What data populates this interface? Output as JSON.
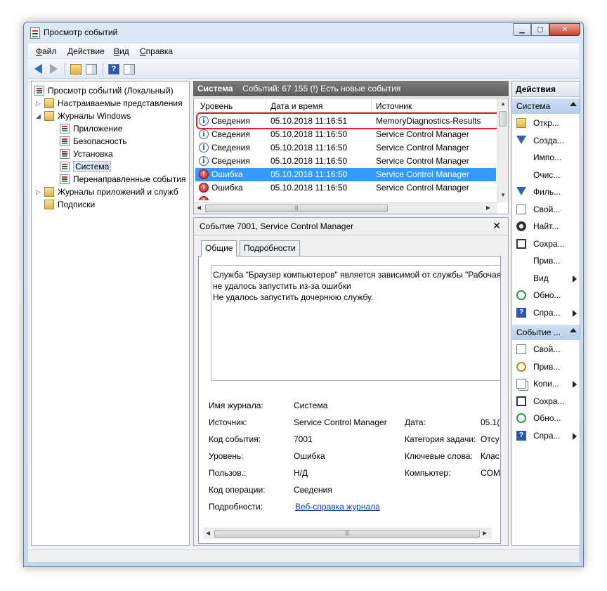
{
  "window": {
    "title": "Просмотр событий"
  },
  "menu": {
    "file": {
      "accel": "Ф",
      "rest": "айл"
    },
    "action": {
      "accel": "Д",
      "rest": "ействие"
    },
    "view": {
      "accel": "В",
      "rest": "ид"
    },
    "help": {
      "accel": "С",
      "rest": "правка"
    }
  },
  "tree": {
    "root": "Просмотр событий (Локальный)",
    "custom_views": "Настраиваемые представления",
    "windows_logs": "Журналы Windows",
    "application": "Приложение",
    "security": "Безопасность",
    "setup": "Установка",
    "system": "Система",
    "forwarded": "Перенаправленные события",
    "app_service_logs": "Журналы приложений и служб",
    "subscriptions": "Подписки"
  },
  "log_header": {
    "name": "Система",
    "summary": "Событий: 67 155 (!) Есть новые события"
  },
  "grid": {
    "columns": {
      "level": "Уровень",
      "datetime": "Дата и время",
      "source": "Источник"
    },
    "rows": [
      {
        "level": "Сведения",
        "datetime": "05.10.2018 11:16:51",
        "source": "MemoryDiagnostics-Results"
      },
      {
        "level": "Сведения",
        "datetime": "05.10.2018 11:16:50",
        "source": "Service Control Manager"
      },
      {
        "level": "Сведения",
        "datetime": "05.10.2018 11:16:50",
        "source": "Service Control Manager"
      },
      {
        "level": "Сведения",
        "datetime": "05.10.2018 11:16:50",
        "source": "Service Control Manager"
      },
      {
        "level": "Ошибка",
        "datetime": "05.10.2018 11:16:50",
        "source": "Service Control Manager"
      },
      {
        "level": "Ошибка",
        "datetime": "05.10.2018 11:16:50",
        "source": "Service Control Manager"
      }
    ]
  },
  "detail": {
    "title": "Событие 7001, Service Control Manager",
    "tabs": {
      "general": "Общие",
      "details": "Подробности"
    },
    "message": {
      "line1": "Служба \"Браузер компьютеров\" является зависимой от службы \"Рабочая",
      "line2": "не удалось запустить из-за ошибки",
      "line3": "Не удалось запустить дочернюю службу."
    },
    "fields": {
      "log_name_label": "Имя журнала:",
      "log_name": "Система",
      "source_label": "Источник:",
      "source": "Service Control Manager",
      "date_label": "Дата:",
      "date": "05.1(",
      "event_id_label": "Код события:",
      "event_id": "7001",
      "task_label": "Категория задачи:",
      "task": "Отсу",
      "level_label": "Уровень:",
      "level": "Ошибка",
      "keywords_label": "Ключевые слова:",
      "keywords": "Клас",
      "user_label": "Пользов.:",
      "user": "Н/Д",
      "computer_label": "Компьютер:",
      "computer": "COM",
      "opcode_label": "Код операции:",
      "opcode": "Сведения",
      "more_info_label": "Подробности:",
      "more_info_link": "Веб-справка журнала"
    }
  },
  "actions": {
    "header": "Действия",
    "group1": "Система",
    "group1_items": [
      "Откр...",
      "Созда...",
      "Импо...",
      "Очис...",
      "Филь...",
      "Свой...",
      "Найт...",
      "Сохра...",
      "Прив...",
      "Вид",
      "Обно...",
      "Спра..."
    ],
    "group2": "Событие ...",
    "group2_items": [
      "Свой...",
      "Прив...",
      "Копи...",
      "Сохра...",
      "Обно...",
      "Спра..."
    ]
  },
  "colors": {
    "selection": "#3399ff",
    "highlight_box": "#e02020",
    "header_bar": "#6b6b6b"
  }
}
